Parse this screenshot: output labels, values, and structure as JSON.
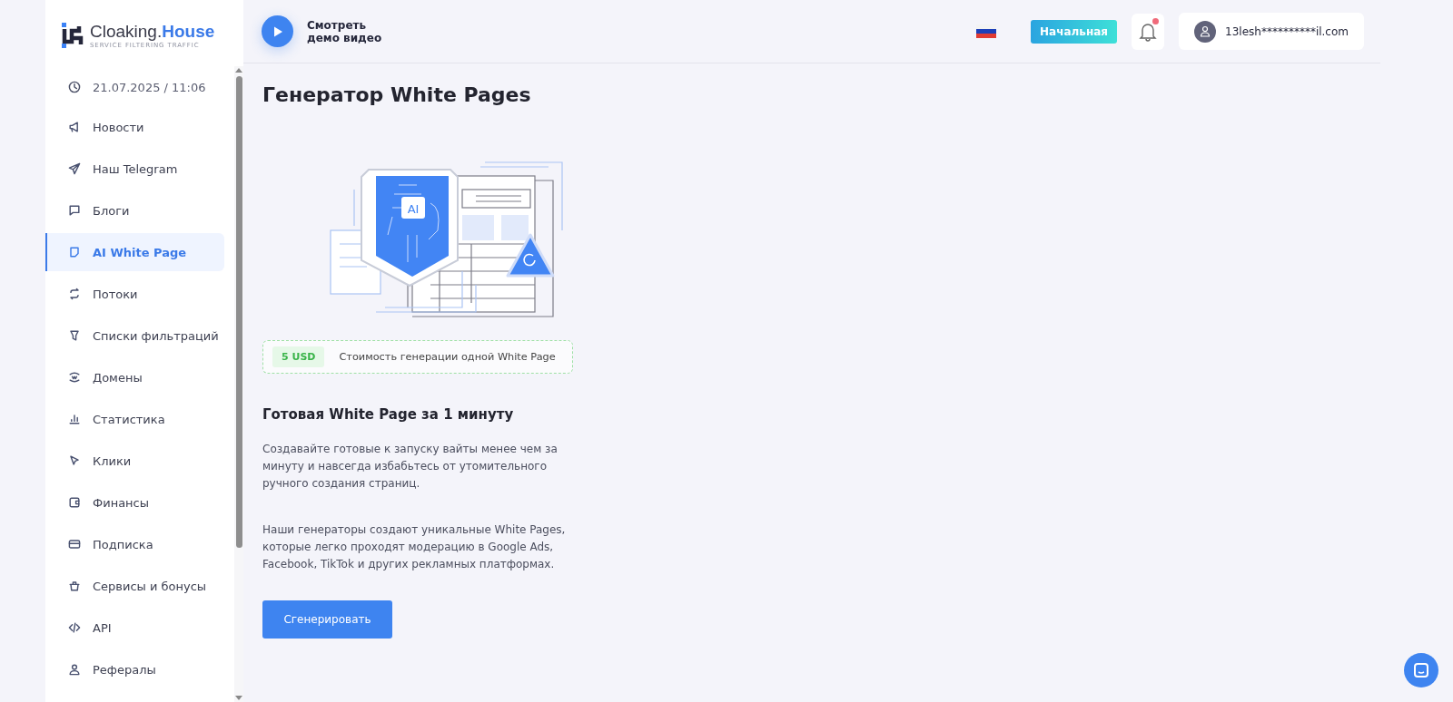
{
  "logo": {
    "name": "Cloaking.",
    "accent": "House",
    "tagline": "SERVICE FILTERING TRAFFIC"
  },
  "sidebar": {
    "datetime": "21.07.2025 / 11:06",
    "items": [
      {
        "label": "Новости",
        "selected": false
      },
      {
        "label": "Наш Telegram",
        "selected": false
      },
      {
        "label": "Блоги",
        "selected": false
      },
      {
        "label": "AI White Page",
        "selected": true
      },
      {
        "label": "Потоки",
        "selected": false
      },
      {
        "label": "Списки фильтраций",
        "selected": false
      },
      {
        "label": "Домены",
        "selected": false
      },
      {
        "label": "Статистика",
        "selected": false
      },
      {
        "label": "Клики",
        "selected": false
      },
      {
        "label": "Финансы",
        "selected": false
      },
      {
        "label": "Подписка",
        "selected": false
      },
      {
        "label": "Сервисы и бонусы",
        "selected": false
      },
      {
        "label": "API",
        "selected": false
      },
      {
        "label": "Рефералы",
        "selected": false
      }
    ]
  },
  "header": {
    "demo": {
      "line1": "Смотреть",
      "line2": "демо видео"
    },
    "home_button": "Начальная",
    "notifications_unread": true,
    "user": "13lesh**********il.com"
  },
  "page": {
    "title": "Генератор White Pages",
    "illustration": {
      "label": "AI"
    },
    "price": {
      "amount": "5 USD",
      "text": "Стоимость генерации одной White Page"
    },
    "subtitle": "Готовая White Page за 1 минуту",
    "paragraphs": [
      "Создавайте готовые к запуску вайты менее чем за минуту и навсегда избабьтесь от утомительного ручного создания страниц.",
      "Наши генераторы создают уникальные White Pages, которые легко проходят модерацию в Google Ads, Facebook, TikTok и других рекламных платформах."
    ],
    "button": "Сгенерировать"
  }
}
